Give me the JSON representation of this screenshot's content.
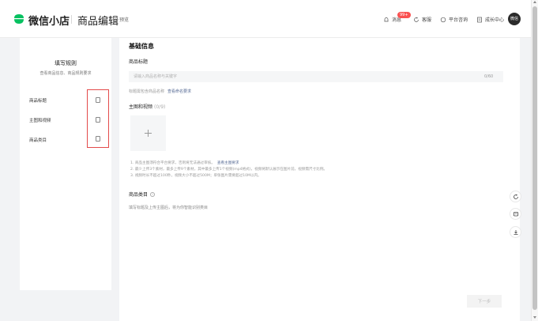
{
  "header": {
    "brand": "微信小店",
    "page_title": "商品编辑",
    "preview": "预览",
    "nav": {
      "messages": "消息",
      "messages_badge": "99+",
      "help": "客服",
      "consult": "平台咨询",
      "growth": "成长中心"
    },
    "avatar_text": "微信"
  },
  "sidebar": {
    "title": "填写规则",
    "subtitle": "查看商品信息、商品规则要求",
    "items": [
      {
        "label": "商品标题"
      },
      {
        "label": "主图和视频"
      },
      {
        "label": "商品类目"
      }
    ]
  },
  "main": {
    "section_title": "基础信息",
    "title_field": {
      "label": "商品标题",
      "placeholder": "请输入商品名称与关键字",
      "value": "",
      "counter": "0/60"
    },
    "title_hint": "标题需包含商品名称",
    "title_hint_link": "查看命名要求",
    "images": {
      "label": "主图和视频",
      "count": "(0/9)",
      "notes": [
        "1. 商品主图须符合平台要求，否则将无法通过审核。",
        "2. 最少上传3个素材，最多上传9个素材。其中最多上传1个视频(mp4格式)，视频将默认展示在图片前，视频需尺寸比例。",
        "3. 视频时长不超过100秒，视频大小不超过500M；单张图片需要超过10M以内。"
      ],
      "notes_link": "查看主图要求"
    },
    "category": {
      "label": "商品类目",
      "hint": "填写标题及上传主图后，将为你智能识别类目"
    },
    "next_button": "下一步"
  },
  "colors": {
    "brand_green": "#07c160",
    "highlight_red": "#e34b4b",
    "link_blue": "#576b95"
  }
}
